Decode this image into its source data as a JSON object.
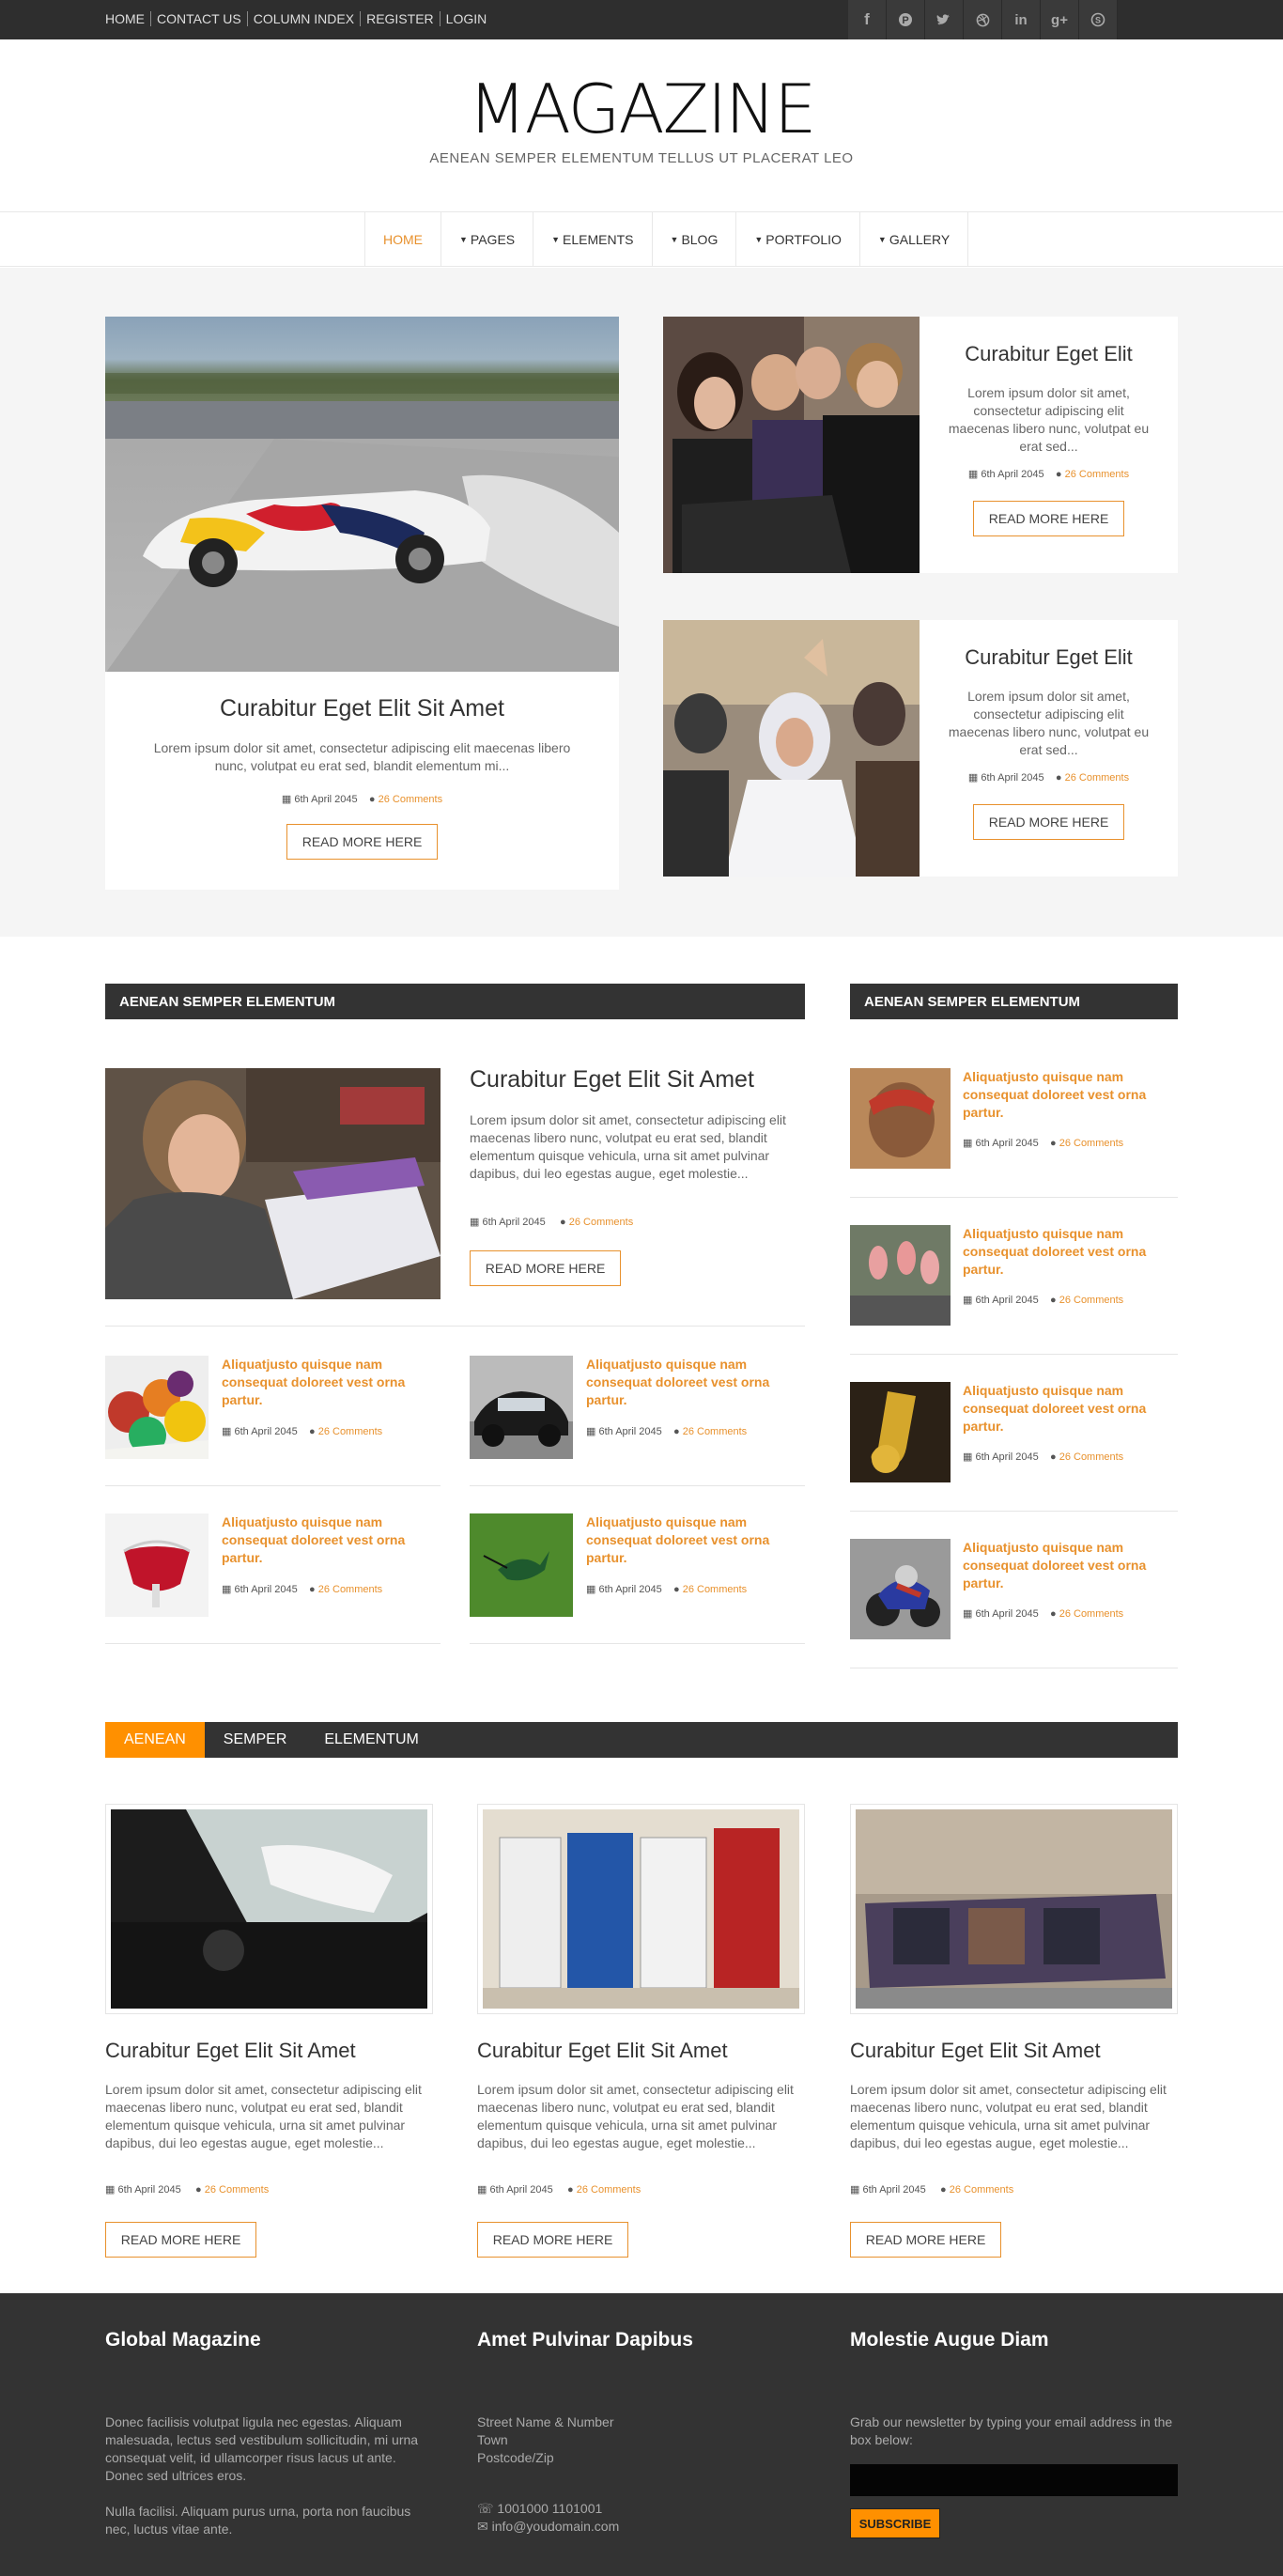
{
  "topbar": {
    "links": [
      "HOME",
      "CONTACT US",
      "COLUMN INDEX",
      "REGISTER",
      "LOGIN"
    ],
    "social_icons": [
      "facebook-icon",
      "pinterest-icon",
      "twitter-icon",
      "dribbble-icon",
      "linkedin-icon",
      "google-plus-icon",
      "skype-icon"
    ]
  },
  "header": {
    "logo": "MAGAZINE",
    "tagline": "AENEAN SEMPER ELEMENTUM TELLUS UT PLACERAT LEO"
  },
  "nav": {
    "items": [
      "HOME",
      "PAGES",
      "ELEMENTS",
      "BLOG",
      "PORTFOLIO",
      "GALLERY"
    ]
  },
  "featured": {
    "main": {
      "title": "Curabitur Eget Elit Sit Amet",
      "excerpt": "Lorem ipsum dolor sit amet, consectetur adipiscing elit maecenas libero nunc, volutpat eu erat sed, blandit elementum mi...",
      "date": "6th April 2045",
      "comments": "26 Comments",
      "button": "READ MORE HERE"
    },
    "side": [
      {
        "title": "Curabitur Eget Elit",
        "excerpt": "Lorem ipsum dolor sit amet, consectetur adipiscing elit maecenas libero nunc, volutpat eu erat sed...",
        "date": "6th April 2045",
        "comments": "26 Comments",
        "button": "READ MORE HERE"
      },
      {
        "title": "Curabitur Eget Elit",
        "excerpt": "Lorem ipsum dolor sit amet, consectetur adipiscing elit maecenas libero nunc, volutpat eu erat sed...",
        "date": "6th April 2045",
        "comments": "26 Comments",
        "button": "READ MORE HERE"
      }
    ]
  },
  "section_left": {
    "heading": "AENEAN SEMPER ELEMENTUM",
    "lead": {
      "title": "Curabitur Eget Elit Sit Amet",
      "excerpt": "Lorem ipsum dolor sit amet, consectetur adipiscing elit maecenas libero nunc, volutpat eu erat sed, blandit elementum quisque vehicula, urna sit amet pulvinar dapibus, dui leo egestas augue, eget molestie...",
      "date": "6th April 2045",
      "comments": "26 Comments",
      "button": "READ MORE HERE"
    },
    "items": [
      {
        "title": "Aliquatjusto quisque nam consequat doloreet vest orna partur.",
        "date": "6th April 2045",
        "comments": "26 Comments"
      },
      {
        "title": "Aliquatjusto quisque nam consequat doloreet vest orna partur.",
        "date": "6th April 2045",
        "comments": "26 Comments"
      },
      {
        "title": "Aliquatjusto quisque nam consequat doloreet vest orna partur.",
        "date": "6th April 2045",
        "comments": "26 Comments"
      },
      {
        "title": "Aliquatjusto quisque nam consequat doloreet vest orna partur.",
        "date": "6th April 2045",
        "comments": "26 Comments"
      }
    ]
  },
  "section_right": {
    "heading": "AENEAN SEMPER ELEMENTUM",
    "items": [
      {
        "title": "Aliquatjusto quisque nam consequat doloreet vest orna partur.",
        "date": "6th April 2045",
        "comments": "26 Comments"
      },
      {
        "title": "Aliquatjusto quisque nam consequat doloreet vest orna partur.",
        "date": "6th April 2045",
        "comments": "26 Comments"
      },
      {
        "title": "Aliquatjusto quisque nam consequat doloreet vest orna partur.",
        "date": "6th April 2045",
        "comments": "26 Comments"
      },
      {
        "title": "Aliquatjusto quisque nam consequat doloreet vest orna partur.",
        "date": "6th April 2045",
        "comments": "26 Comments"
      }
    ]
  },
  "tabs": {
    "labels": [
      "AENEAN",
      "SEMPER",
      "ELEMENTUM"
    ],
    "active": "AENEAN"
  },
  "tab_posts": [
    {
      "title": "Curabitur Eget Elit Sit Amet",
      "excerpt": "Lorem ipsum dolor sit amet, consectetur adipiscing elit maecenas libero nunc, volutpat eu erat sed, blandit elementum quisque vehicula, urna sit amet pulvinar dapibus, dui leo egestas augue, eget molestie...",
      "date": "6th April 2045",
      "comments": "26 Comments",
      "button": "READ MORE HERE"
    },
    {
      "title": "Curabitur Eget Elit Sit Amet",
      "excerpt": "Lorem ipsum dolor sit amet, consectetur adipiscing elit maecenas libero nunc, volutpat eu erat sed, blandit elementum quisque vehicula, urna sit amet pulvinar dapibus, dui leo egestas augue, eget molestie...",
      "date": "6th April 2045",
      "comments": "26 Comments",
      "button": "READ MORE HERE"
    },
    {
      "title": "Curabitur Eget Elit Sit Amet",
      "excerpt": "Lorem ipsum dolor sit amet, consectetur adipiscing elit maecenas libero nunc, volutpat eu erat sed, blandit elementum quisque vehicula, urna sit amet pulvinar dapibus, dui leo egestas augue, eget molestie...",
      "date": "6th April 2045",
      "comments": "26 Comments",
      "button": "READ MORE HERE"
    }
  ],
  "footer": {
    "col1": {
      "heading": "Global Magazine",
      "para1": "Donec facilisis volutpat ligula nec egestas. Aliquam malesuada, lectus sed vestibulum sollicitudin, mi urna consequat velit, id ullamcorper risus lacus ut ante. Donec sed ultrices eros.",
      "para2": "Nulla facilisi. Aliquam purus urna, porta non faucibus nec, luctus vitae ante."
    },
    "col2": {
      "heading": "Amet Pulvinar Dapibus",
      "address": [
        "Street Name & Number",
        "Town",
        "Postcode/Zip"
      ],
      "phone": "1001000 1101001",
      "email": "info@youdomain.com"
    },
    "col3": {
      "heading": "Molestie Augue Diam",
      "text": "Grab our newsletter by typing your email address in the box below:",
      "input_placeholder": "",
      "button": "SUBSCRIBE"
    }
  },
  "colors": {
    "accent": "#e8912d",
    "tab_active": "#ff9000",
    "dark": "#333333"
  }
}
